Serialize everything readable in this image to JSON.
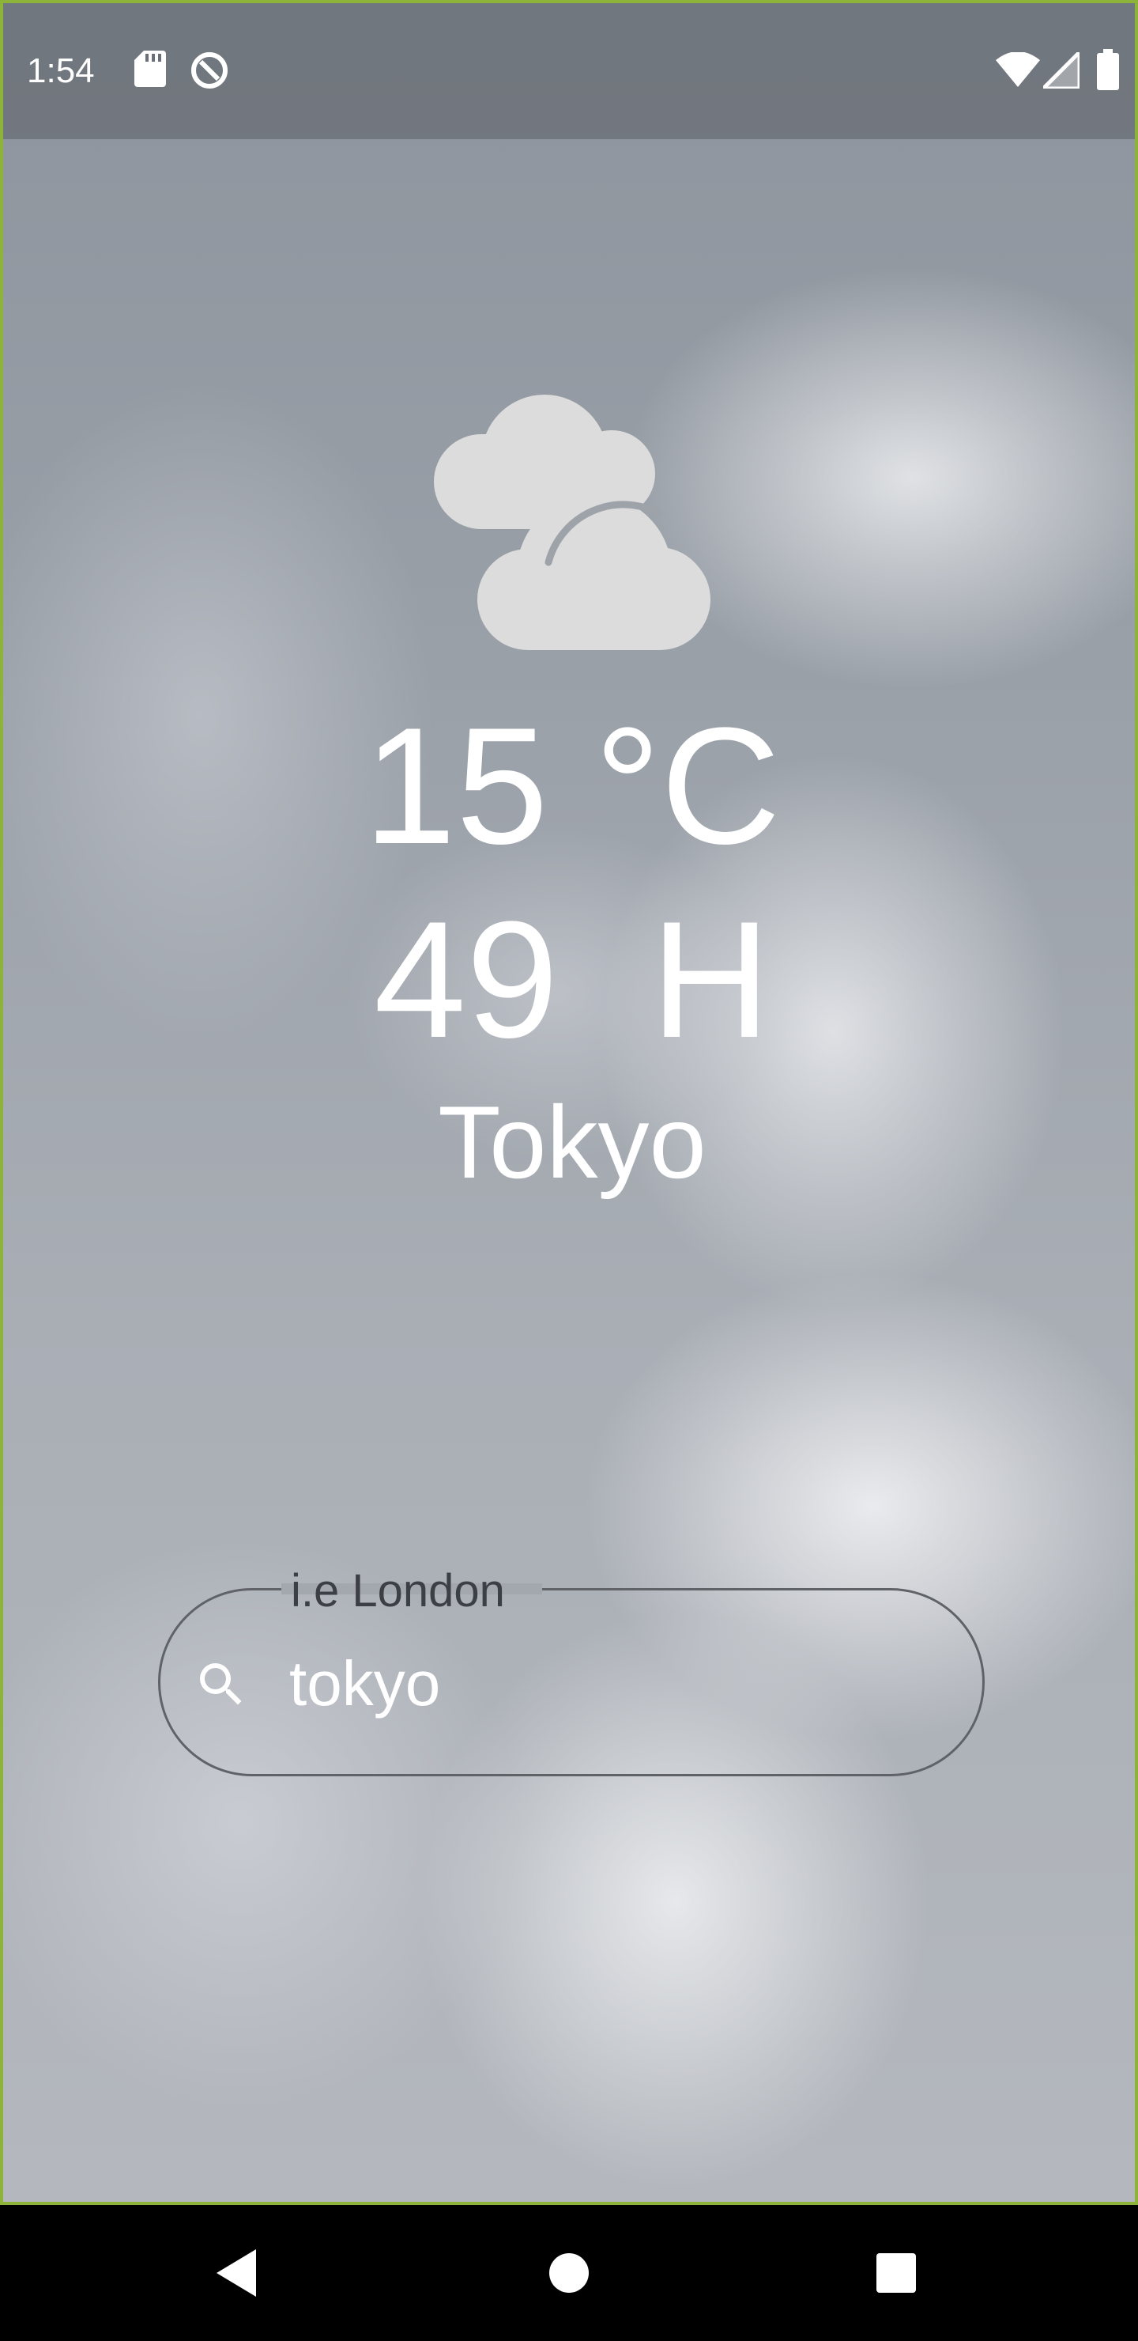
{
  "status_bar": {
    "time": "1:54",
    "left_icons": [
      "sd-card-icon",
      "do-not-disturb-icon"
    ],
    "right_icons": [
      "wifi-icon",
      "cellular-signal-icon",
      "battery-icon"
    ]
  },
  "weather": {
    "condition_icon": "cloudy-icon",
    "temperature": "15 °C",
    "humidity": "49  H",
    "city": "Tokyo"
  },
  "search": {
    "label": "i.e London",
    "value": "tokyo",
    "icon": "search-icon"
  },
  "nav_bar": {
    "buttons": [
      "back-icon",
      "home-icon",
      "recents-icon"
    ]
  },
  "colors": {
    "frame_border": "#8db33a",
    "text": "#ffffff",
    "icon_fill": "#dcdcdc",
    "outline": "#5f6368"
  }
}
